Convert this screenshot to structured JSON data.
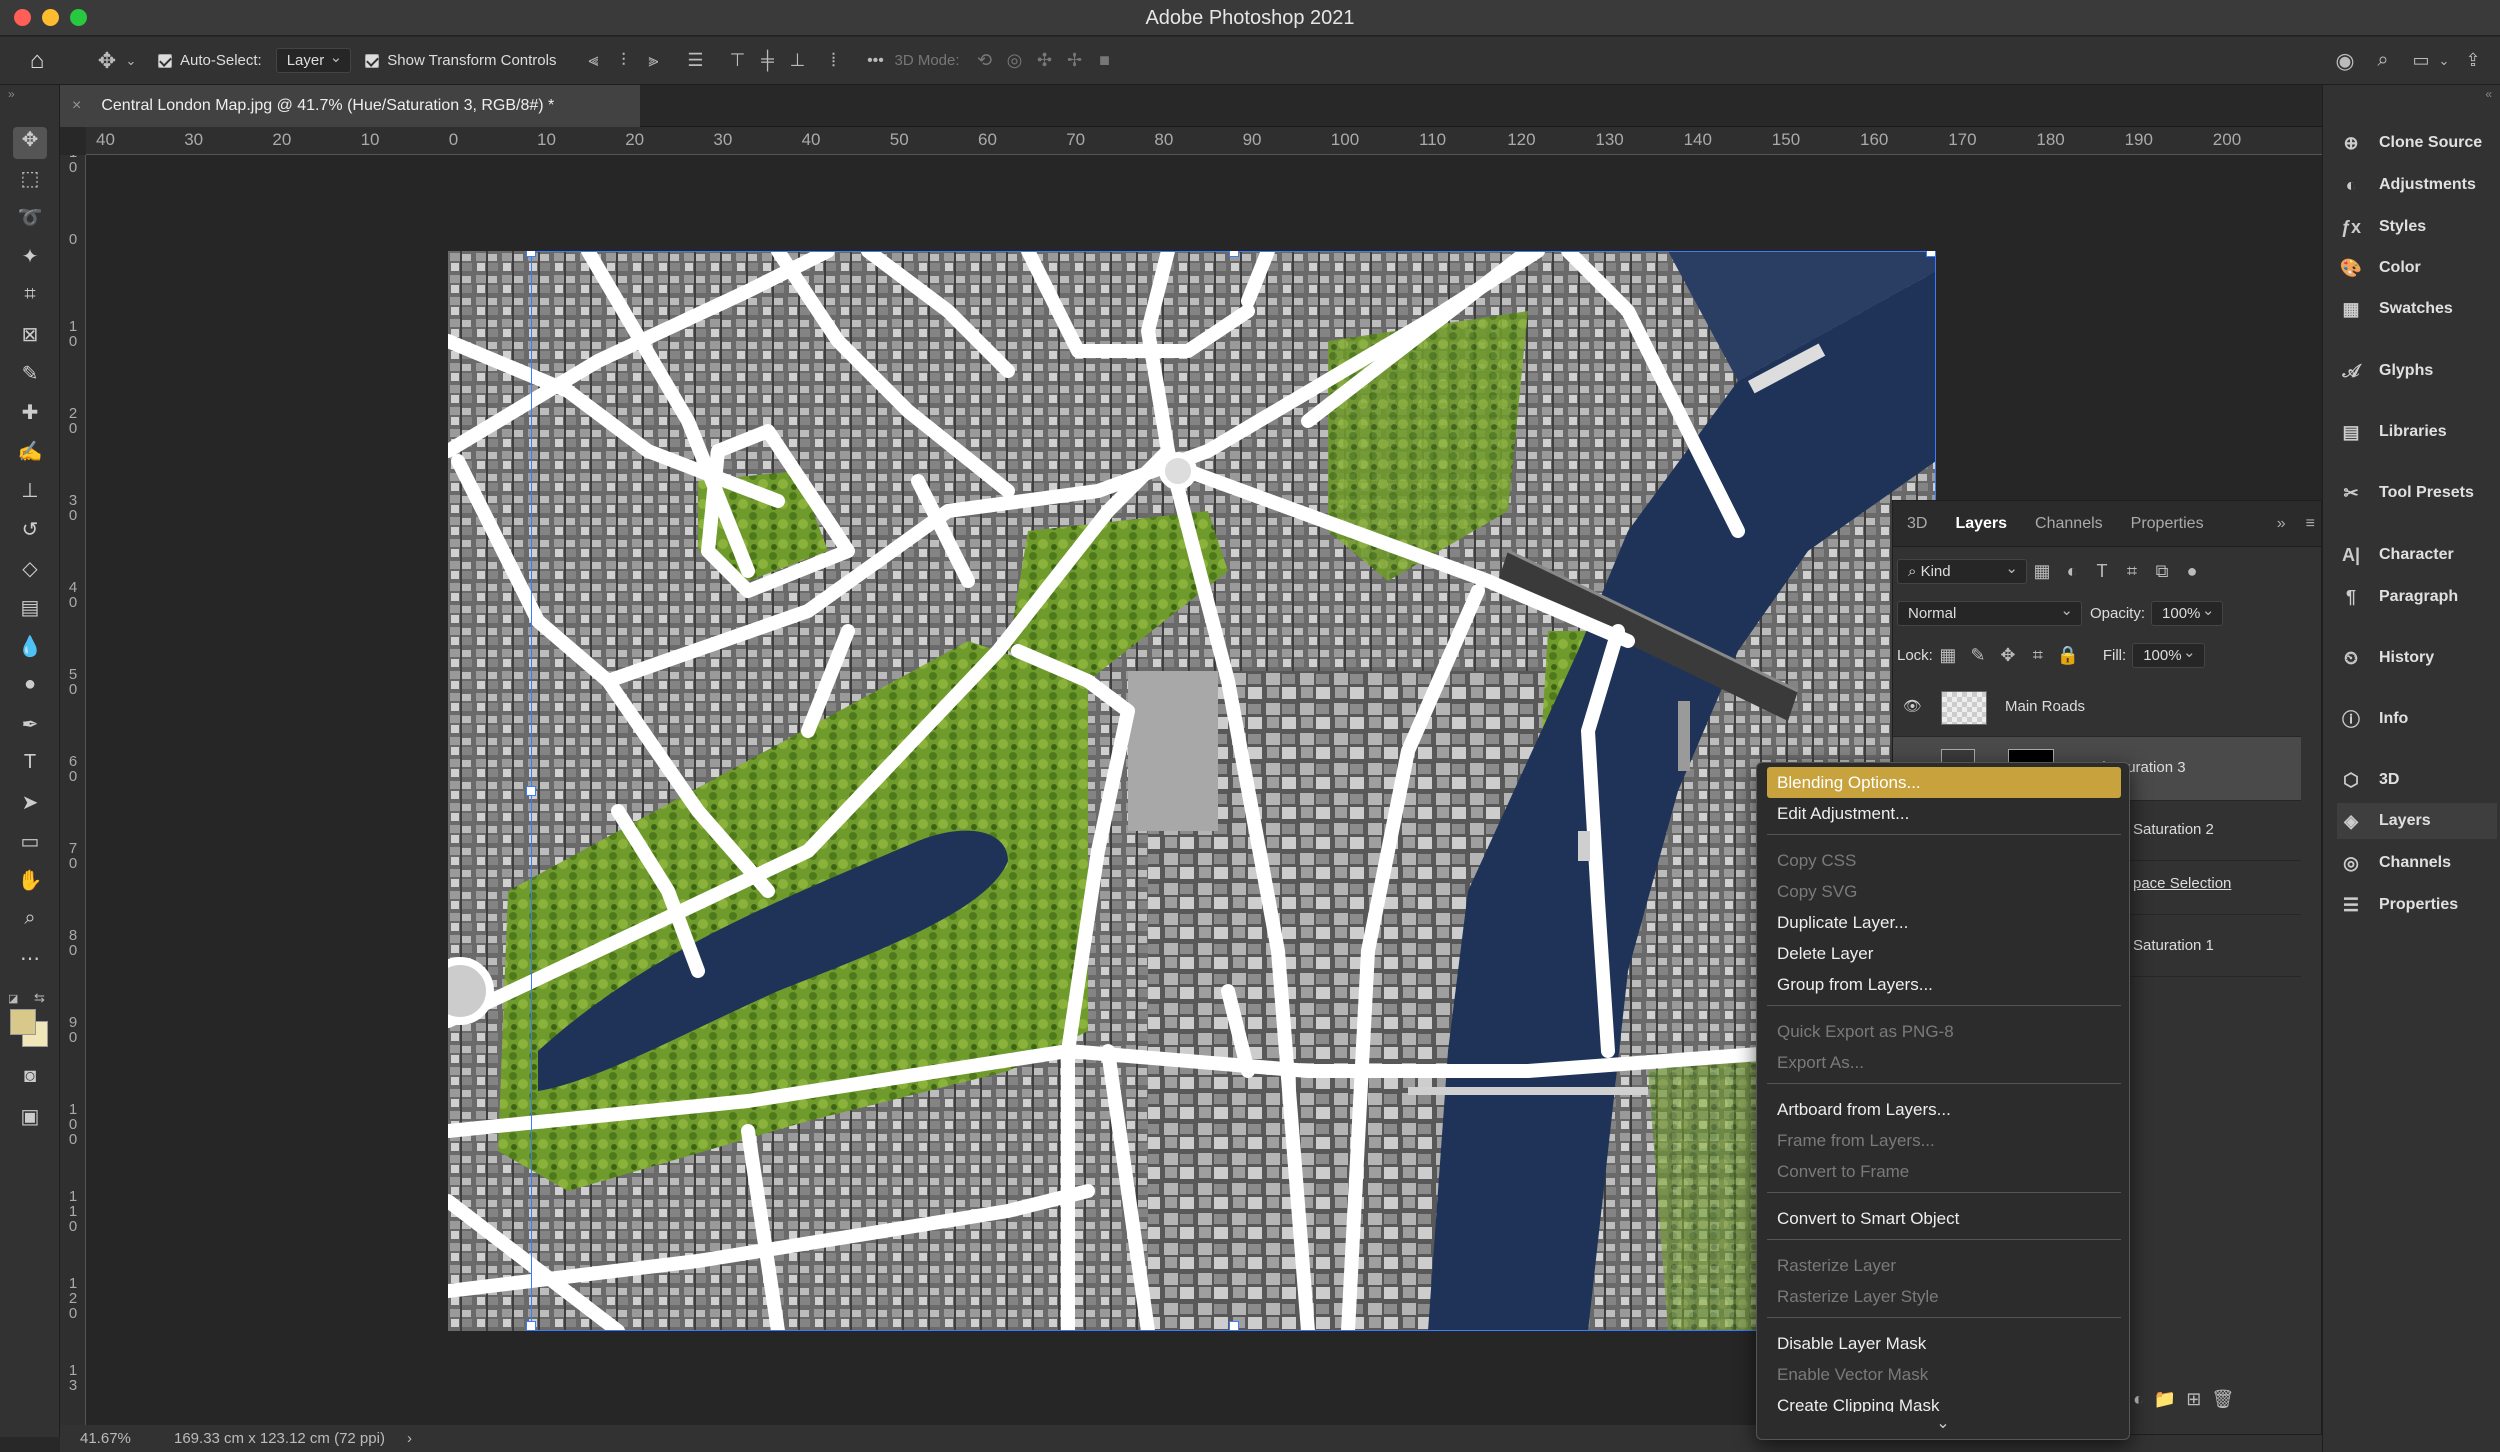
{
  "app": {
    "window_title": "Adobe Photoshop 2021",
    "traffic_lights": {
      "close": "#ff5f57",
      "minimize": "#febc2e",
      "zoom": "#28c840"
    }
  },
  "options_bar": {
    "auto_select_label": "Auto-Select:",
    "auto_select_value": "Layer",
    "show_transform_label": "Show Transform Controls",
    "mode_3d_label": "3D Mode:",
    "more": "•••"
  },
  "document": {
    "tab_title": "Central London Map.jpg @ 41.7% (Hue/Saturation 3, RGB/8#) *",
    "close_glyph": "×"
  },
  "ruler_top": [
    "40",
    "30",
    "20",
    "10",
    "0",
    "10",
    "20",
    "30",
    "40",
    "50",
    "60",
    "70",
    "80",
    "90",
    "100",
    "110",
    "120",
    "130",
    "140",
    "150",
    "160",
    "170",
    "180",
    "190",
    "200"
  ],
  "ruler_left": [
    "1\n0",
    "0",
    "1\n0",
    "2\n0",
    "3\n0",
    "4\n0",
    "5\n0",
    "6\n0",
    "7\n0",
    "8\n0",
    "9\n0",
    "1\n0\n0",
    "1\n1\n0",
    "1\n2\n0",
    "1\n3"
  ],
  "status": {
    "zoom": "41.67%",
    "doc_size": "169.33 cm x 123.12 cm (72 ppi)",
    "arrow": "›"
  },
  "tools": [
    "move-tool",
    "marquee-tool",
    "lasso-tool",
    "magic-wand-tool",
    "crop-tool",
    "frame-tool",
    "eyedropper-tool",
    "healing-tool",
    "brush-tool",
    "stamp-tool",
    "history-brush-tool",
    "eraser-tool",
    "gradient-tool",
    "blur-tool",
    "dodge-tool",
    "pen-tool",
    "type-tool",
    "path-select-tool",
    "rectangle-tool",
    "hand-tool",
    "zoom-tool",
    "more-tools"
  ],
  "colors": {
    "foreground": "#d8c98a",
    "background": "#f1e6b8",
    "menu_highlight": "#c7a23d",
    "water": "#1f3358",
    "park": "#6f9a2c"
  },
  "right_dock": [
    {
      "icon": "clone-source-icon",
      "label": "Clone Source"
    },
    {
      "icon": "adjustments-icon",
      "label": "Adjustments"
    },
    {
      "icon": "styles-icon",
      "label": "Styles"
    },
    {
      "icon": "color-icon",
      "label": "Color"
    },
    {
      "icon": "swatches-icon",
      "label": "Swatches"
    },
    {
      "icon": "glyphs-icon",
      "label": "Glyphs"
    },
    {
      "icon": "libraries-icon",
      "label": "Libraries"
    },
    {
      "icon": "tool-presets-icon",
      "label": "Tool Presets"
    },
    {
      "icon": "character-icon",
      "label": "Character"
    },
    {
      "icon": "paragraph-icon",
      "label": "Paragraph"
    },
    {
      "icon": "history-icon",
      "label": "History"
    },
    {
      "icon": "info-icon",
      "label": "Info"
    },
    {
      "icon": "3d-icon",
      "label": "3D"
    },
    {
      "icon": "layers-icon",
      "label": "Layers"
    },
    {
      "icon": "channels-icon",
      "label": "Channels"
    },
    {
      "icon": "properties-icon",
      "label": "Properties"
    }
  ],
  "layers_panel": {
    "tabs": [
      "3D",
      "Layers",
      "Channels",
      "Properties"
    ],
    "active_tab": "Layers",
    "filter_label": "Kind",
    "blend_mode": "Normal",
    "opacity_label": "Opacity:",
    "opacity_value": "100%",
    "lock_label": "Lock:",
    "fill_label": "Fill:",
    "fill_value": "100%",
    "layers": [
      {
        "name": "Main Roads"
      },
      {
        "name": "Hue/Saturation 3"
      },
      {
        "name": "Saturation 2"
      },
      {
        "name": "pace Selection"
      },
      {
        "name": "Saturation 1"
      }
    ]
  },
  "context_menu": {
    "items": [
      {
        "label": "Blending Options...",
        "state": "highlight"
      },
      {
        "label": "Edit Adjustment...",
        "state": "enabled"
      },
      {
        "label": "Copy CSS",
        "state": "disabled"
      },
      {
        "label": "Copy SVG",
        "state": "disabled"
      },
      {
        "label": "Duplicate Layer...",
        "state": "enabled"
      },
      {
        "label": "Delete Layer",
        "state": "enabled"
      },
      {
        "label": "Group from Layers...",
        "state": "enabled"
      },
      {
        "label": "Quick Export as PNG-8",
        "state": "disabled"
      },
      {
        "label": "Export As...",
        "state": "disabled"
      },
      {
        "label": "Artboard from Layers...",
        "state": "enabled"
      },
      {
        "label": "Frame from Layers...",
        "state": "disabled"
      },
      {
        "label": "Convert to Frame",
        "state": "disabled"
      },
      {
        "label": "Convert to Smart Object",
        "state": "enabled"
      },
      {
        "label": "Rasterize Layer",
        "state": "disabled"
      },
      {
        "label": "Rasterize Layer Style",
        "state": "disabled"
      },
      {
        "label": "Disable Layer Mask",
        "state": "enabled"
      },
      {
        "label": "Enable Vector Mask",
        "state": "disabled"
      },
      {
        "label": "Create Clipping Mask",
        "state": "enabled"
      }
    ],
    "scroll_arrow": "⌄"
  }
}
